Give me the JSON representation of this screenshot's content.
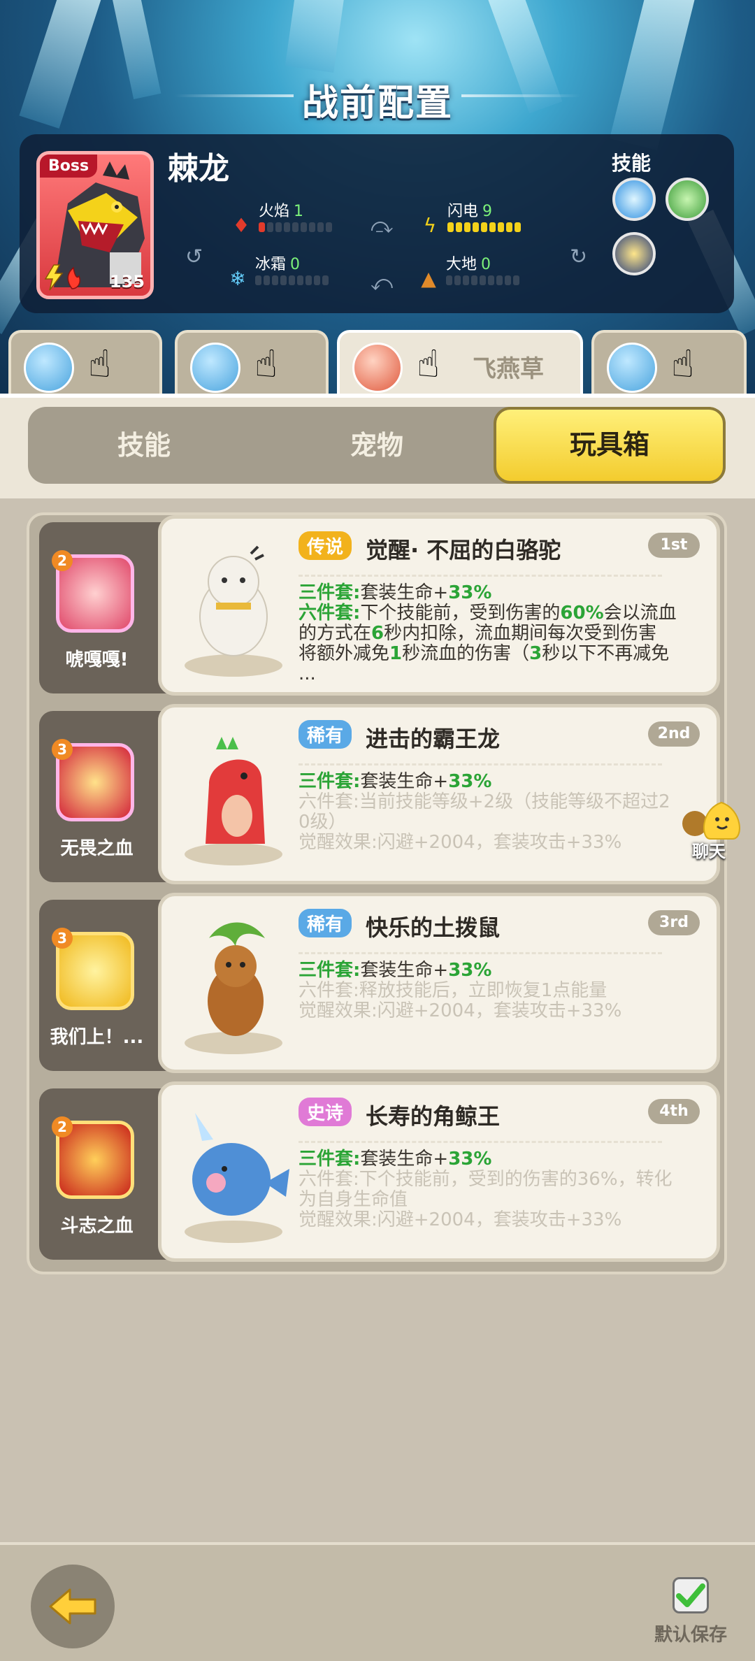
{
  "screen": {
    "title": "战前配置"
  },
  "boss": {
    "badge": "Boss",
    "name": "棘龙",
    "level": "135",
    "stats": [
      {
        "label": "火焰",
        "value": "1",
        "level": 1,
        "max": 9,
        "color": "#e23b2b",
        "icon": "fire-icon"
      },
      {
        "label": "闪电",
        "value": "9",
        "level": 9,
        "max": 9,
        "color": "#f4d21a",
        "icon": "lightning-icon"
      },
      {
        "label": "冰霜",
        "value": "0",
        "level": 0,
        "max": 9,
        "color": "#62c9f5",
        "icon": "snowflake-icon"
      },
      {
        "label": "大地",
        "value": "0",
        "level": 0,
        "max": 9,
        "color": "#e08a2a",
        "icon": "earth-icon"
      }
    ],
    "skills_label": "技能"
  },
  "party": [
    {
      "name": "",
      "icon": "pet-avatar-icon"
    },
    {
      "name": "",
      "icon": "pet-avatar-icon"
    },
    {
      "name": "飞燕草",
      "icon": "hero-avatar-icon"
    },
    {
      "name": "",
      "icon": "pet-avatar-icon"
    }
  ],
  "tabs": [
    "技能",
    "宠物",
    "玩具箱"
  ],
  "active_tab": 2,
  "toys": [
    {
      "skill_level": "2",
      "skill_name": "唬嘎嘎!",
      "rarity": "传说",
      "rarity_color": "#f2b21c",
      "name": "觉醒· 不屈的白骆驼",
      "rank": "1st",
      "l1k": "三件套:",
      "l1t": "套装生命+",
      "l1n": "33%",
      "l2k": "六件套:",
      "l2a": "下个技能前，受到伤害的",
      "l2n": "60%",
      "l2b": "会以流血",
      "l3a": "的方式在",
      "l3n": "6",
      "l3b": "秒内扣除，流血期间每次受到伤害",
      "l4a": "将额外减免",
      "l4n": "1",
      "l4b": "秒流血的伤害（",
      "l4n2": "3",
      "l4c": "秒以下不再减免",
      "l5": "..."
    },
    {
      "skill_level": "3",
      "skill_name": "无畏之血",
      "rarity": "稀有",
      "rarity_color": "#5aa9e6",
      "name": "进击的霸王龙",
      "rank": "2nd",
      "l1k": "三件套:",
      "l1t": "套装生命+",
      "l1n": "33%",
      "l2": "六件套:当前技能等级+2级（技能等级不超过2",
      "l3": "0级）",
      "l4": "觉醒效果:闪避+2004，套装攻击+33%"
    },
    {
      "skill_level": "3",
      "skill_name": "我们上！...",
      "rarity": "稀有",
      "rarity_color": "#5aa9e6",
      "name": "快乐的土拨鼠",
      "rank": "3rd",
      "l1k": "三件套:",
      "l1t": "套装生命+",
      "l1n": "33%",
      "l2": "六件套:释放技能后，立即恢复1点能量",
      "l3": "觉醒效果:闪避+2004，套装攻击+33%"
    },
    {
      "skill_level": "2",
      "skill_name": "斗志之血",
      "rarity": "史诗",
      "rarity_color": "#e07ad6",
      "name": "长寿的角鲸王",
      "rank": "4th",
      "l1k": "三件套:",
      "l1t": "套装生命+",
      "l1n": "33%",
      "l2": "六件套:下个技能前，受到的伤害的36%，转化",
      "l3": "为自身生命值",
      "l4": "觉醒效果:闪避+2004，套装攻击+33%"
    }
  ],
  "chat": {
    "label": "聊天"
  },
  "footer": {
    "save_label": "默认保存",
    "save_checked": true
  }
}
